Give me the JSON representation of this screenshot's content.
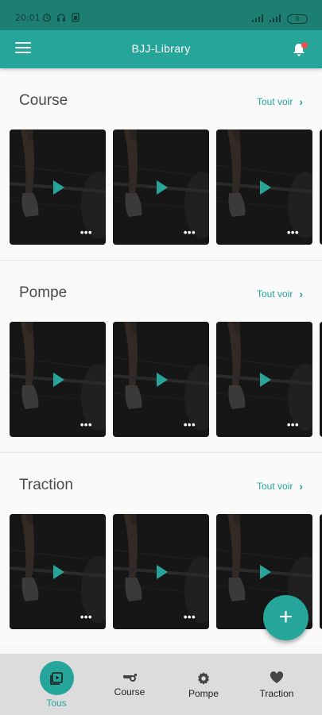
{
  "status_bar": {
    "time": "20:01",
    "battery": "6"
  },
  "app_bar": {
    "title": "BJJ-Library"
  },
  "sections": [
    {
      "title": "Course",
      "see_all": "Tout voir"
    },
    {
      "title": "Pompe",
      "see_all": "Tout voir"
    },
    {
      "title": "Traction",
      "see_all": "Tout voir"
    }
  ],
  "card": {
    "more": "•••"
  },
  "fab": {
    "label": "+"
  },
  "bottom_nav": {
    "items": [
      {
        "label": "Tous",
        "icon": "play-library-icon",
        "active": true
      },
      {
        "label": "Course",
        "icon": "whistle-icon"
      },
      {
        "label": "Pompe",
        "icon": "gear-icon"
      },
      {
        "label": "Traction",
        "icon": "heart-icon"
      }
    ]
  },
  "colors": {
    "accent": "#26a69a",
    "status_bar": "#1d7f72",
    "notification": "#ef5350",
    "nav_bg": "#dcdcdc"
  }
}
